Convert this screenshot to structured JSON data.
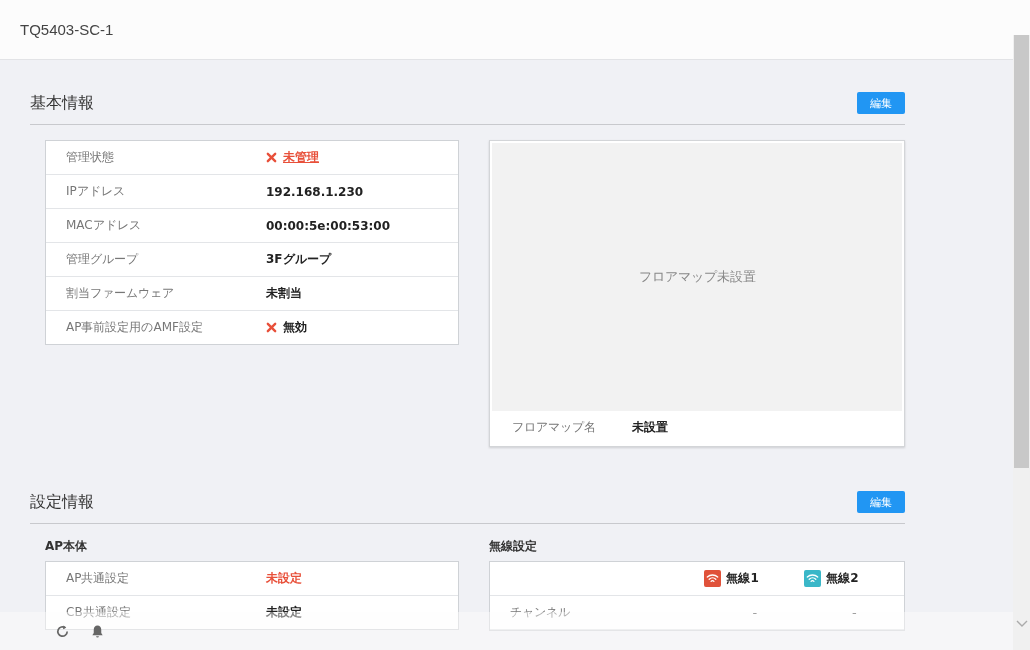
{
  "window": {
    "title": "TQ5403-SC-1"
  },
  "basic_info": {
    "title": "基本情報",
    "edit_button": "編集",
    "rows": [
      {
        "label": "管理状態",
        "value": "未管理",
        "kind": "cross",
        "error": true,
        "link": true
      },
      {
        "label": "IPアドレス",
        "value": "192.168.1.230",
        "kind": "plain",
        "error": false,
        "link": false
      },
      {
        "label": "MACアドレス",
        "value": "00:00:5e:00:53:00",
        "kind": "plain",
        "error": false,
        "link": false
      },
      {
        "label": "管理グループ",
        "value": "3Fグループ",
        "kind": "plain",
        "error": false,
        "link": false
      },
      {
        "label": "割当ファームウェア",
        "value": "未割当",
        "kind": "plain",
        "error": false,
        "link": false
      },
      {
        "label": "AP事前設定用のAMF設定",
        "value": "無効",
        "kind": "cross",
        "error": false,
        "link": false
      }
    ],
    "floor_map": {
      "empty_text": "フロアマップ未設置",
      "name_label": "フロアマップ名",
      "name_value": "未設置"
    }
  },
  "settings_info": {
    "title": "設定情報",
    "edit_button": "編集",
    "ap_body": {
      "title": "AP本体",
      "rows": [
        {
          "label": "AP共通設定",
          "value": "未設定",
          "error": true
        },
        {
          "label": "CB共通設定",
          "value": "未設定",
          "error": false
        }
      ]
    },
    "wireless": {
      "title": "無線設定",
      "columns": [
        {
          "label": "無線1",
          "color": "#e0523a"
        },
        {
          "label": "無線2",
          "color": "#3ab7c8"
        }
      ],
      "rows": [
        {
          "label": "チャンネル",
          "values": [
            "-",
            "-"
          ]
        }
      ]
    }
  }
}
